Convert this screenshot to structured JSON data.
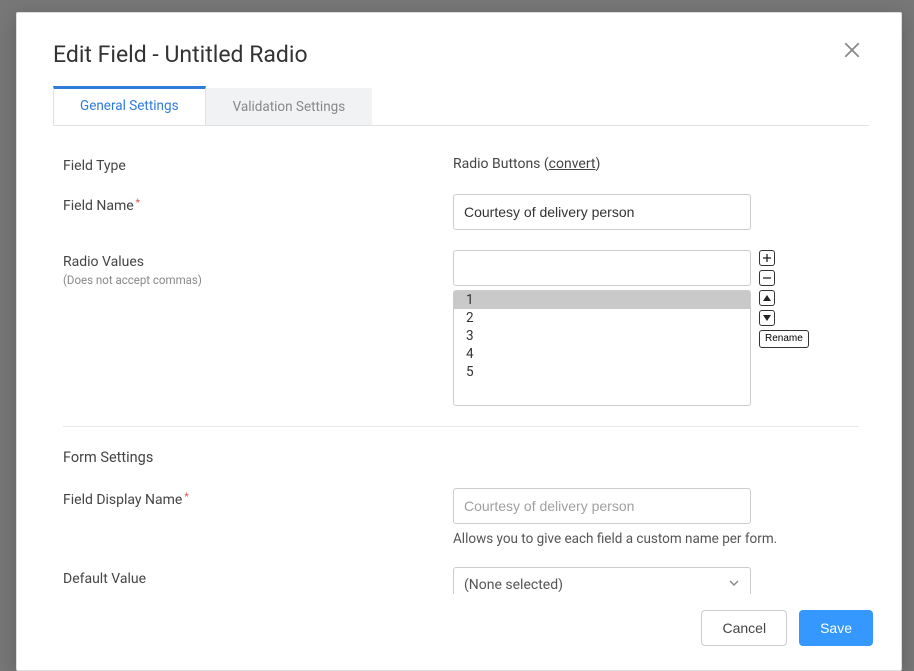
{
  "modal": {
    "title": "Edit Field - Untitled Radio",
    "tabs": {
      "general": "General Settings",
      "validation": "Validation Settings"
    },
    "footer": {
      "cancel": "Cancel",
      "save": "Save"
    }
  },
  "form": {
    "field_type_label": "Field Type",
    "field_type_value_prefix": "Radio Buttons (",
    "field_type_convert": "convert",
    "field_type_value_suffix": ")",
    "field_name_label": "Field Name",
    "field_name_value": "Courtesy of delivery person",
    "radio_values_label": "Radio Values",
    "radio_values_hint": "(Does not accept commas)",
    "radio_new_value": "",
    "radio_options": [
      "1",
      "2",
      "3",
      "4",
      "5"
    ],
    "rename_label": "Rename",
    "section_title": "Form Settings",
    "display_name_label": "Field Display Name",
    "display_name_placeholder": "Courtesy of delivery person",
    "display_name_help": "Allows you to give each field a custom name per form.",
    "default_value_label": "Default Value",
    "default_value_selected": "(None selected)"
  }
}
